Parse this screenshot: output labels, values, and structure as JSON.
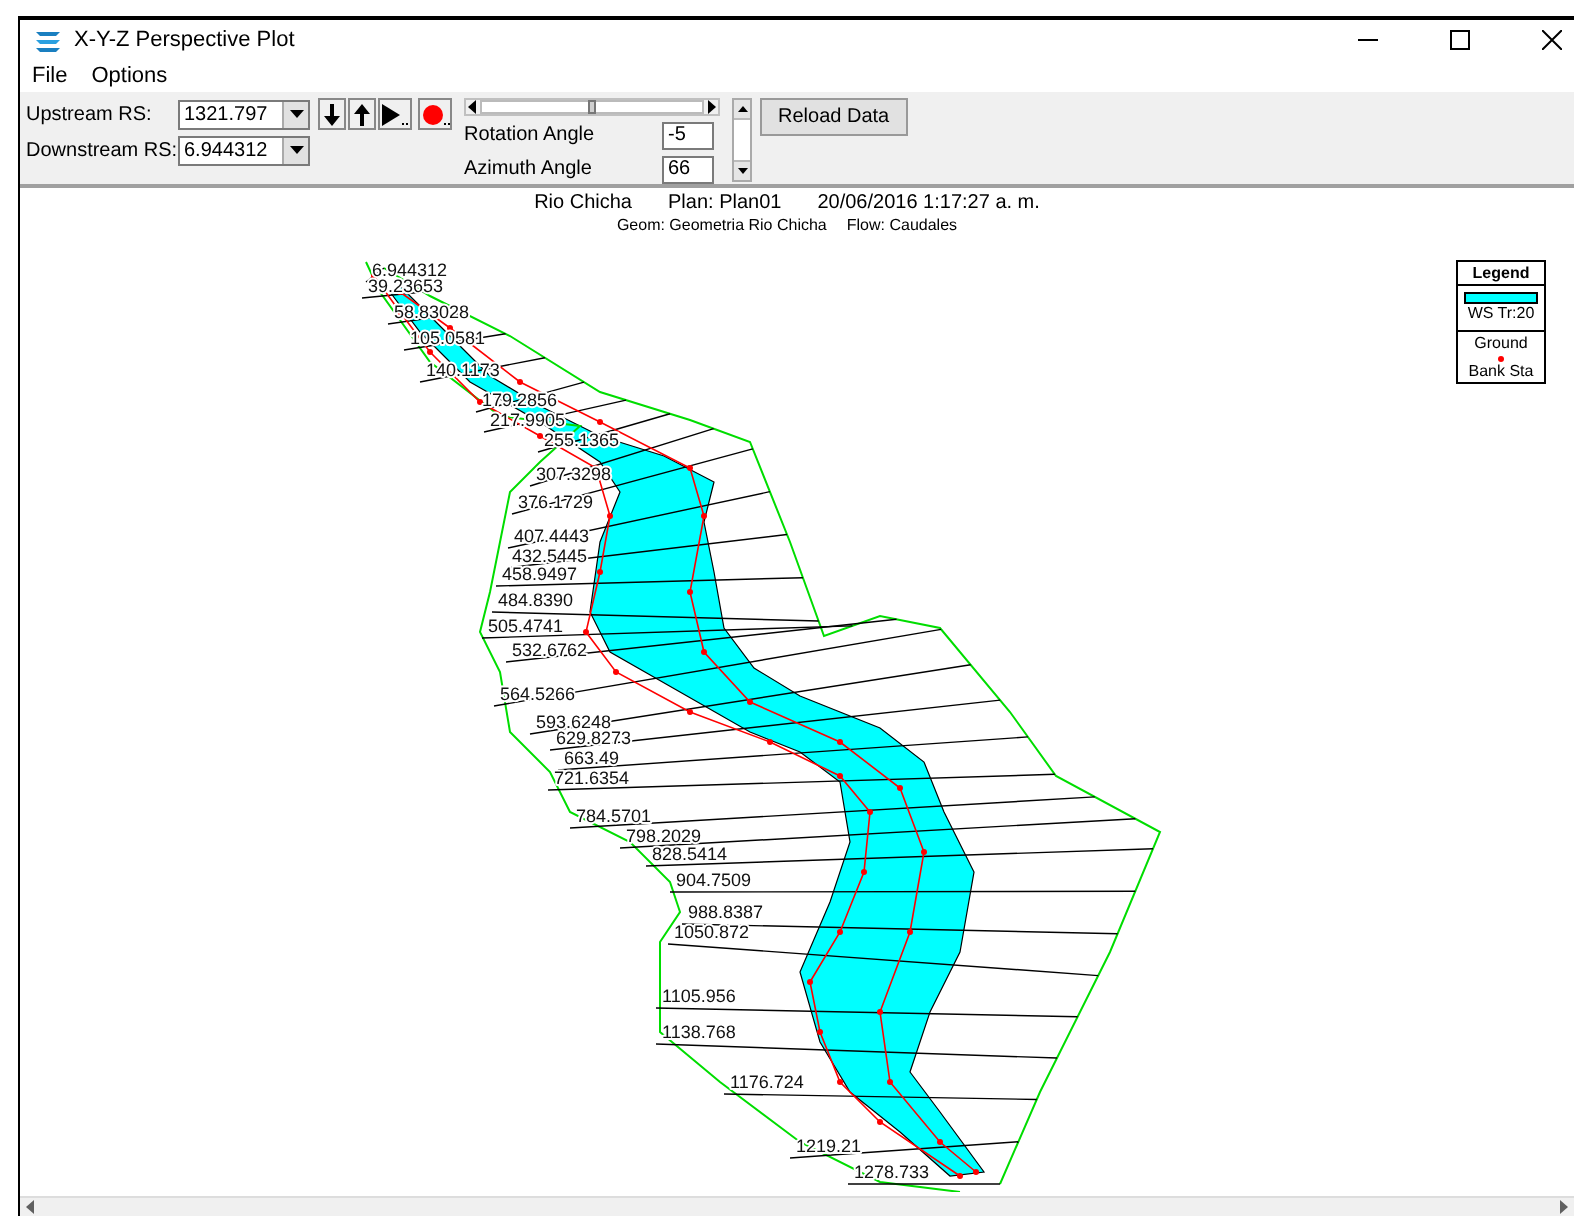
{
  "window": {
    "title": "X-Y-Z Perspective Plot"
  },
  "menu": [
    {
      "label": "File"
    },
    {
      "label": "Options"
    }
  ],
  "toolbar": {
    "upstream": {
      "label": "Upstream RS:",
      "value": "1321.797"
    },
    "downstream": {
      "label": "Downstream RS:",
      "value": "6.944312"
    },
    "slider": {
      "level": 0.5
    },
    "rotation": {
      "label": "Rotation Angle",
      "value": "-5"
    },
    "azimuth": {
      "label": "Azimuth Angle",
      "value": "66"
    },
    "reload_button": "Reload Data"
  },
  "plot": {
    "title_parts": [
      "Rio Chicha",
      "Plan: Plan01",
      "20/06/2016  1:17:27 a. m."
    ],
    "subtitle_parts": [
      "Geom: Geometria Rio Chicha",
      "Flow: Caudales"
    ],
    "station_labels": [
      "6.944312",
      "39.23653",
      "58.83028",
      "105.0581",
      "140.1173",
      "179.2856",
      "217.9905",
      "255.1365",
      "307.3298",
      "376.1729",
      "407.4443",
      "432.5445",
      "458.9497",
      "484.8390",
      "505.4741",
      "532.6762",
      "564.5266",
      "593.6248",
      "629.8273",
      "663.49",
      "721.6354",
      "784.5701",
      "798.2029",
      "828.5414",
      "904.7509",
      "988.8387",
      "1050.872",
      "1105.956",
      "1138.768",
      "1176.724",
      "1219.21",
      "1278.733"
    ],
    "legend": {
      "title": "Legend",
      "entries": [
        {
          "kind": "swatch",
          "label": "WS Tr:20",
          "color": "#00ffff"
        },
        {
          "kind": "line",
          "label": "Ground",
          "color": "#000000"
        },
        {
          "kind": "dot",
          "label": "Bank Sta",
          "color": "#ff0000"
        }
      ]
    }
  }
}
